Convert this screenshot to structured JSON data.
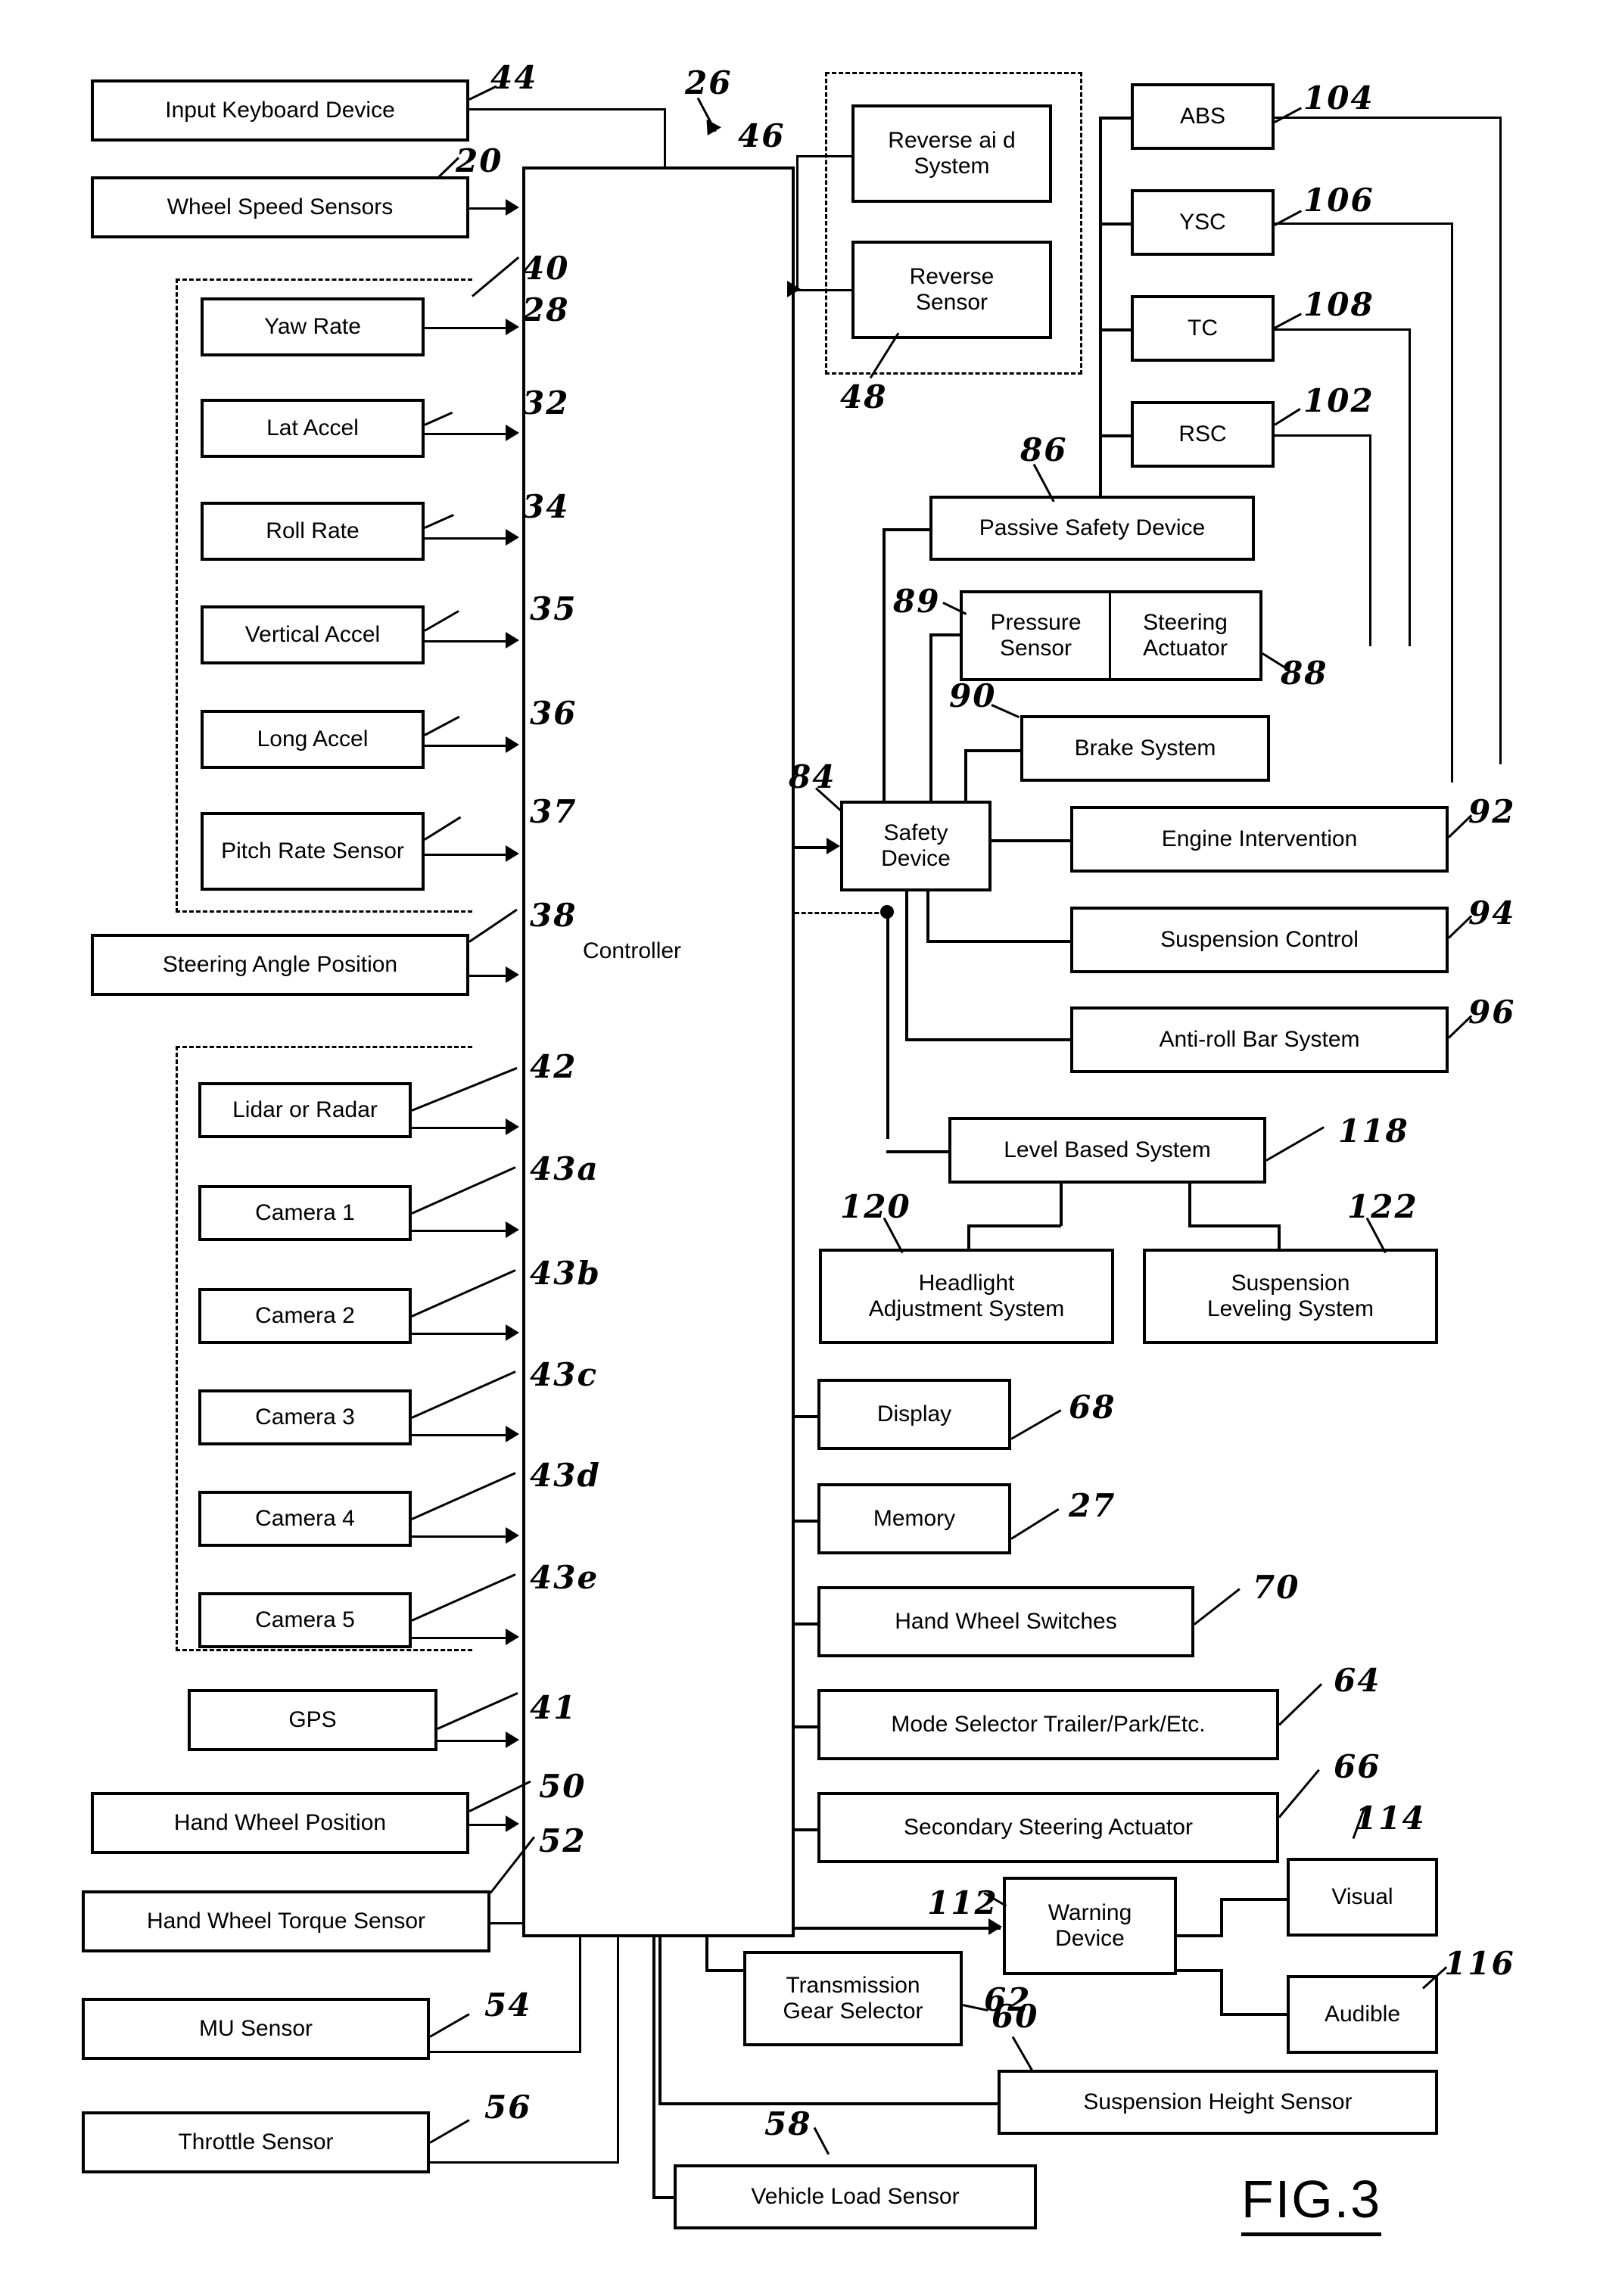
{
  "figure": {
    "caption": "FIG.3",
    "controller_label": "Controller"
  },
  "left_inputs": [
    {
      "label": "Input Keyboard Device",
      "ref": "44"
    },
    {
      "label": "Wheel Speed Sensors",
      "ref": "20"
    },
    {
      "label": "Steering Angle Position",
      "ref": "38"
    },
    {
      "label": "GPS",
      "ref": "41"
    },
    {
      "label": "Hand Wheel Position",
      "ref": "50"
    },
    {
      "label": "Hand  Wheel Torque Sensor",
      "ref": "52"
    },
    {
      "label": "MU Sensor",
      "ref": "54"
    },
    {
      "label": "Throttle Sensor",
      "ref": "56"
    }
  ],
  "inertial_group": {
    "ref": "40",
    "items": [
      {
        "label": "Yaw Rate",
        "ref": "28"
      },
      {
        "label": "Lat Accel",
        "ref": "32"
      },
      {
        "label": "Roll Rate",
        "ref": "34"
      },
      {
        "label": "Vertical Accel",
        "ref": "35"
      },
      {
        "label": "Long Accel",
        "ref": "36"
      },
      {
        "label": "Pitch Rate Sensor",
        "ref": "37"
      }
    ]
  },
  "vision_group": {
    "ref": "42",
    "items": [
      {
        "label": "Lidar or Radar",
        "ref": "42"
      },
      {
        "label": "Camera 1",
        "ref": "43a"
      },
      {
        "label": "Camera 2",
        "ref": "43b"
      },
      {
        "label": "Camera 3",
        "ref": "43c"
      },
      {
        "label": "Camera 4",
        "ref": "43d"
      },
      {
        "label": "Camera 5",
        "ref": "43e"
      }
    ]
  },
  "controller": {
    "ref": "26",
    "out_ref": "46"
  },
  "reverse_group": {
    "ref": "48",
    "items": [
      {
        "label": "Reverse ai d\nSystem",
        "line1": "Reverse ai d",
        "line2": "System"
      },
      {
        "label": "Reverse\nSensor",
        "line1": "Reverse",
        "line2": "Sensor"
      }
    ]
  },
  "control_modules": [
    {
      "label": "ABS",
      "ref": "104"
    },
    {
      "label": "YSC",
      "ref": "106"
    },
    {
      "label": "TC",
      "ref": "108"
    },
    {
      "label": "RSC",
      "ref": "102"
    }
  ],
  "safety_chain": {
    "passive_safety_device": {
      "label": "Passive Safety Device",
      "ref": "86"
    },
    "pressure_sensor": {
      "label_line1": "Pressure",
      "label_line2": "Sensor",
      "ref": "89"
    },
    "steering_actuator": {
      "label_line1": "Steering",
      "label_line2": "Actuator",
      "ref": "88"
    },
    "brake_system": {
      "label": "Brake System",
      "ref": "90"
    },
    "safety_device": {
      "label_line1": "Safety",
      "label_line2": "Device",
      "ref": "84"
    },
    "engine_intervention": {
      "label": "Engine Intervention",
      "ref": "92"
    },
    "suspension_control": {
      "label": "Suspension Control",
      "ref": "94"
    },
    "anti_roll_bar_system": {
      "label": "Anti-roll Bar System",
      "ref": "96"
    }
  },
  "level_branch": {
    "level_based_system": {
      "label": "Level Based System",
      "ref": "118"
    },
    "headlight_adjustment_system": {
      "label_line1": "Headlight",
      "label_line2": "Adjustment System",
      "ref": "120"
    },
    "suspension_leveling_system": {
      "label_line1": "Suspension",
      "label_line2": "Leveling System",
      "ref": "122"
    }
  },
  "hmi_outputs": [
    {
      "label": "Display",
      "ref": "68"
    },
    {
      "label": "Memory",
      "ref": "27"
    },
    {
      "label": "Hand Wheel Switches",
      "ref": "70"
    },
    {
      "label": "Mode Selector Trailer/Park/Etc.",
      "ref": "64"
    },
    {
      "label": "Secondary Steering Actuator",
      "ref": "66"
    }
  ],
  "warning_branch": {
    "warning_device": {
      "label_line1": "Warning",
      "label_line2": "Device",
      "ref": "112"
    },
    "visual": {
      "label": "Visual",
      "ref": "114"
    },
    "audible": {
      "label": "Audible",
      "ref": "116"
    }
  },
  "bottom_inputs": [
    {
      "label_line1": "Transmission",
      "label_line2": "Gear Selector",
      "ref": "62"
    },
    {
      "label": "Suspension Height Sensor",
      "ref": "60"
    },
    {
      "label": "Vehicle Load Sensor",
      "ref": "58"
    }
  ]
}
